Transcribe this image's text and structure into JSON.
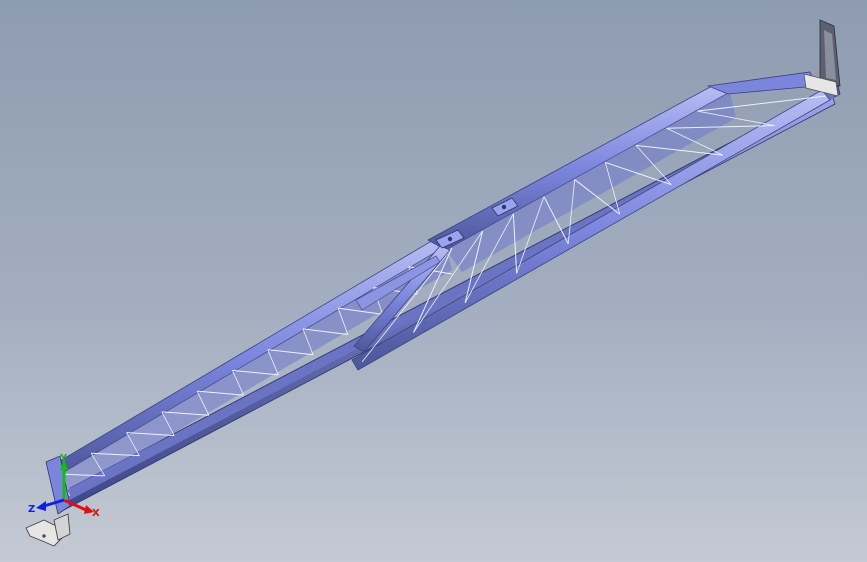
{
  "viewport": {
    "background_top": "#8e9cb1",
    "background_bottom": "#c4cad4"
  },
  "model": {
    "description_hidden": "",
    "steel_color": "#7c86de",
    "steel_dark": "#4d5699",
    "brace_color": "#f2f4ff",
    "plate_color": "#e6e6e6"
  },
  "triad": {
    "x_label": "X",
    "y_label": "Y",
    "z_label": "Z",
    "x_color": "#e01010",
    "y_color": "#10c010",
    "z_color": "#1020e0"
  }
}
